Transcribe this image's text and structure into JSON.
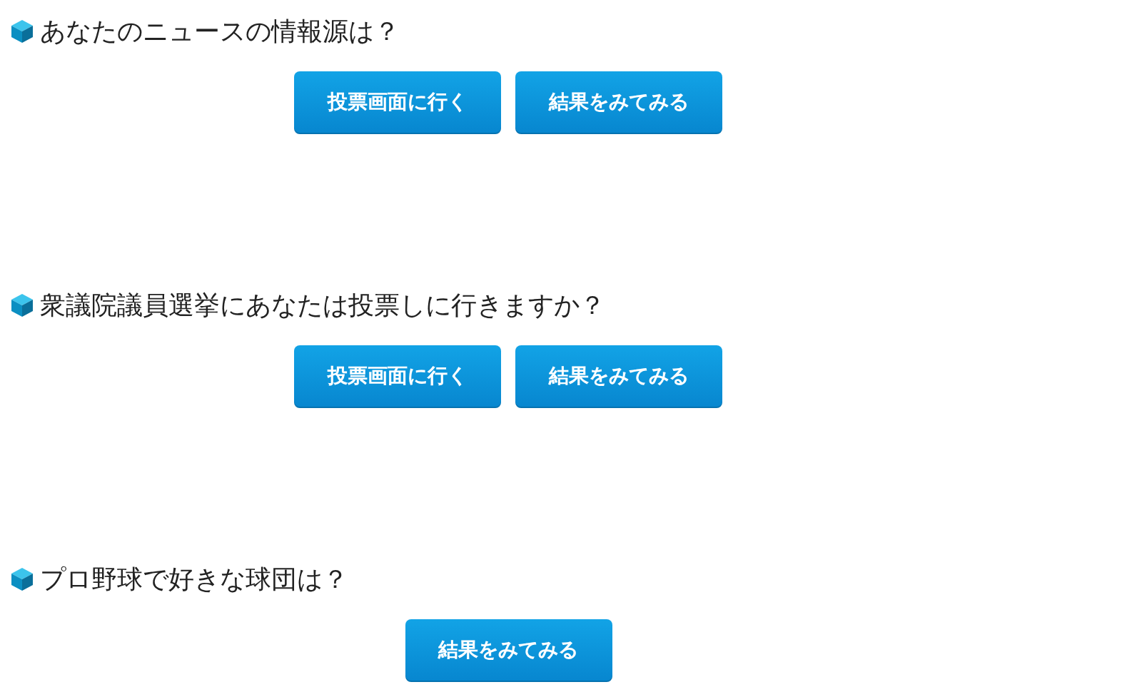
{
  "polls": [
    {
      "question": "あなたのニュースの情報源は？",
      "buttons": [
        {
          "label": "投票画面に行く"
        },
        {
          "label": "結果をみてみる"
        }
      ]
    },
    {
      "question": "衆議院議員選挙にあなたは投票しに行きますか？",
      "buttons": [
        {
          "label": "投票画面に行く"
        },
        {
          "label": "結果をみてみる"
        }
      ]
    },
    {
      "question": "プロ野球で好きな球団は？",
      "buttons": [
        {
          "label": "結果をみてみる"
        }
      ]
    }
  ]
}
